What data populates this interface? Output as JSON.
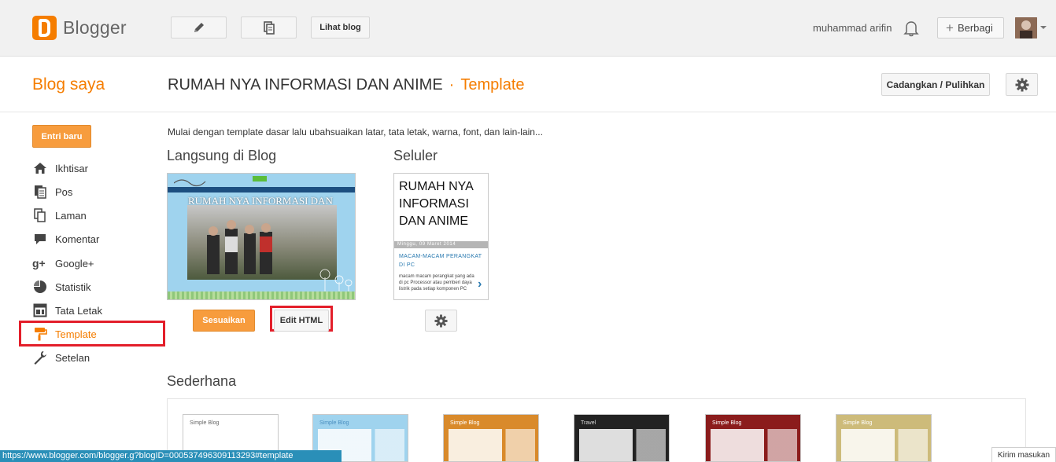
{
  "app": {
    "logo_text": "Blogger",
    "view_blog_label": "Lihat blog",
    "user_name": "muhammad arifin",
    "share_label": "Berbagi"
  },
  "header": {
    "section_title": "Blog saya",
    "blog_name": "RUMAH NYA INFORMASI DAN ANIME",
    "separator": "·",
    "current_page": "Template",
    "backup_label": "Cadangkan / Pulihkan"
  },
  "sidebar": {
    "new_post_label": "Entri baru",
    "items": [
      {
        "label": "Ikhtisar",
        "icon": "home-icon"
      },
      {
        "label": "Pos",
        "icon": "posts-icon"
      },
      {
        "label": "Laman",
        "icon": "pages-icon"
      },
      {
        "label": "Komentar",
        "icon": "comment-icon"
      },
      {
        "label": "Google+",
        "icon": "google-plus-icon"
      },
      {
        "label": "Statistik",
        "icon": "stats-icon"
      },
      {
        "label": "Tata Letak",
        "icon": "layout-icon"
      },
      {
        "label": "Template",
        "icon": "paint-roller-icon",
        "active": true
      },
      {
        "label": "Setelan",
        "icon": "wrench-icon"
      }
    ]
  },
  "main": {
    "intro_text": "Mulai dengan template dasar lalu ubahsuaikan latar, tata letak, warna, font, dan lain-lain...",
    "live_title": "Langsung di Blog",
    "mobile_title": "Seluler",
    "preview_blog_title": "RUMAH NYA INFORMASI DAN ANIME",
    "customize_label": "Sesuaikan",
    "edit_html_label": "Edit HTML",
    "mobile_preview": {
      "title": "RUMAH NYA INFORMASI DAN ANIME",
      "date": "Minggu, 09 Maret 2014",
      "post_title": "MACAM-MACAM PERANGKAT DI PC",
      "post_text": "macam macam perangkat yang ada di pc  Processor atau pemberi daya listrik pada setiap komponen PC"
    },
    "simple_title": "Sederhana",
    "thumbnails": [
      {
        "label": "Simple Blog",
        "bg": "#ffffff",
        "accent": "#666666"
      },
      {
        "label": "Simple Blog",
        "bg": "#9fd3ee",
        "accent": "#4a8fc0"
      },
      {
        "label": "Simple Blog",
        "bg": "#d98a2b",
        "accent": "#ffffff"
      },
      {
        "label": "Travel",
        "bg": "#222222",
        "accent": "#dddddd"
      },
      {
        "label": "Simple Blog",
        "bg": "#8b1c1c",
        "accent": "#ffffff"
      },
      {
        "label": "Simple Blog",
        "bg": "#cdbb7a",
        "accent": "#ffffff"
      }
    ]
  },
  "status": {
    "url": "https://www.blogger.com/blogger.g?blogID=000537496309113293#template",
    "feedback_label": "Kirim masukan"
  },
  "colors": {
    "accent": "#f57d00",
    "highlight_red": "#e31e2a",
    "primary_button": "#f79c3d"
  }
}
